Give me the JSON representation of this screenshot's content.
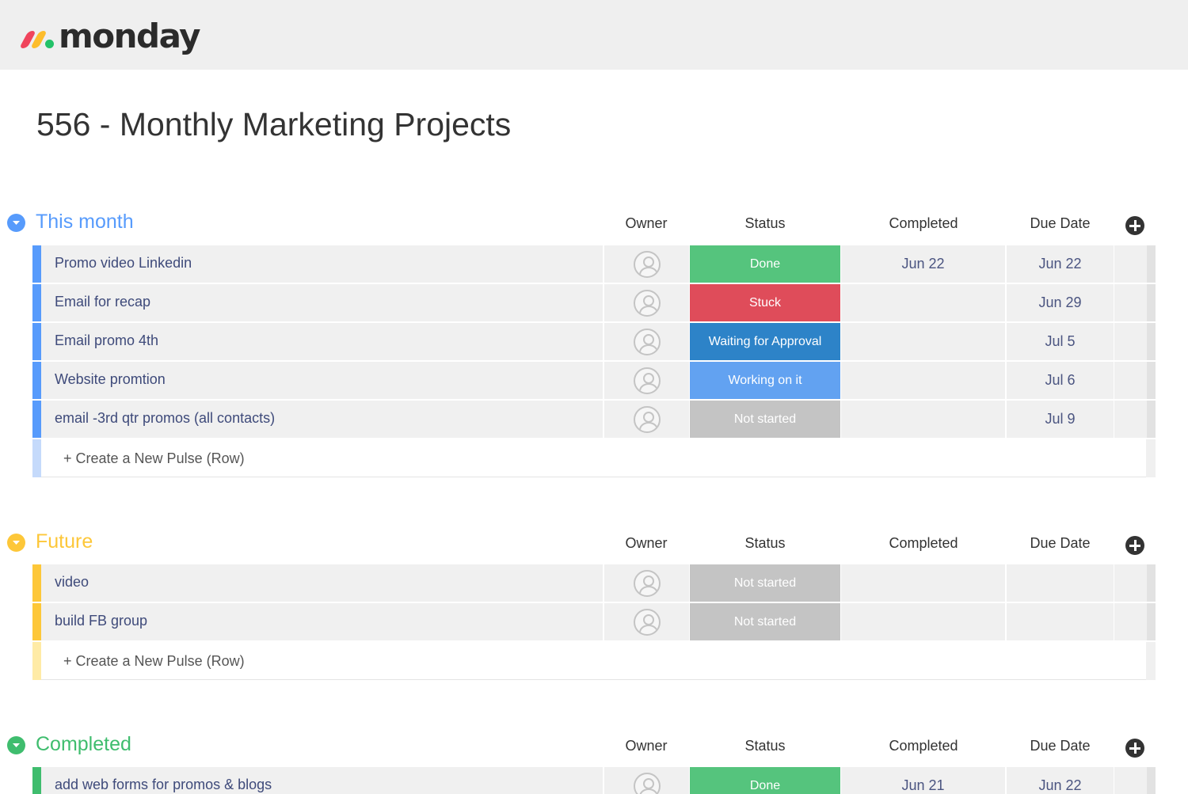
{
  "app": {
    "logo_text": "monday"
  },
  "board": {
    "title": "556 - Monthly Marketing Projects"
  },
  "columns": {
    "owner": "Owner",
    "status": "Status",
    "completed": "Completed",
    "due": "Due Date"
  },
  "create_label": "+ Create a New Pulse (Row)",
  "colors": {
    "this_month": "#579bfc",
    "this_month_light": "#c5dafb",
    "future": "#fdc739",
    "future_light": "#ffeba6",
    "completed": "#3fbd6e",
    "status_done": "#55c47d",
    "status_stuck": "#df4c5a",
    "status_waiting": "#2d83c8",
    "status_working": "#62a2f1",
    "status_not_started": "#c4c4c4"
  },
  "groups": {
    "this_month": {
      "name": "This month",
      "rows": [
        {
          "name": "Promo video Linkedin",
          "status": "Done",
          "completed": "Jun 22",
          "due": "Jun 22"
        },
        {
          "name": "Email for recap",
          "status": "Stuck",
          "completed": "",
          "due": "Jun 29"
        },
        {
          "name": "Email promo 4th",
          "status": "Waiting for Approval",
          "completed": "",
          "due": "Jul 5"
        },
        {
          "name": "Website promtion",
          "status": "Working on it",
          "completed": "",
          "due": "Jul 6"
        },
        {
          "name": "email -3rd qtr promos (all contacts)",
          "status": "Not started",
          "completed": "",
          "due": "Jul 9"
        }
      ]
    },
    "future": {
      "name": "Future",
      "rows": [
        {
          "name": "video",
          "status": "Not started",
          "completed": "",
          "due": ""
        },
        {
          "name": "build FB group",
          "status": "Not started",
          "completed": "",
          "due": ""
        }
      ]
    },
    "completed": {
      "name": "Completed",
      "rows": [
        {
          "name": "add web forms for promos & blogs",
          "status": "Done",
          "completed": "Jun 21",
          "due": "Jun 22"
        }
      ]
    }
  }
}
